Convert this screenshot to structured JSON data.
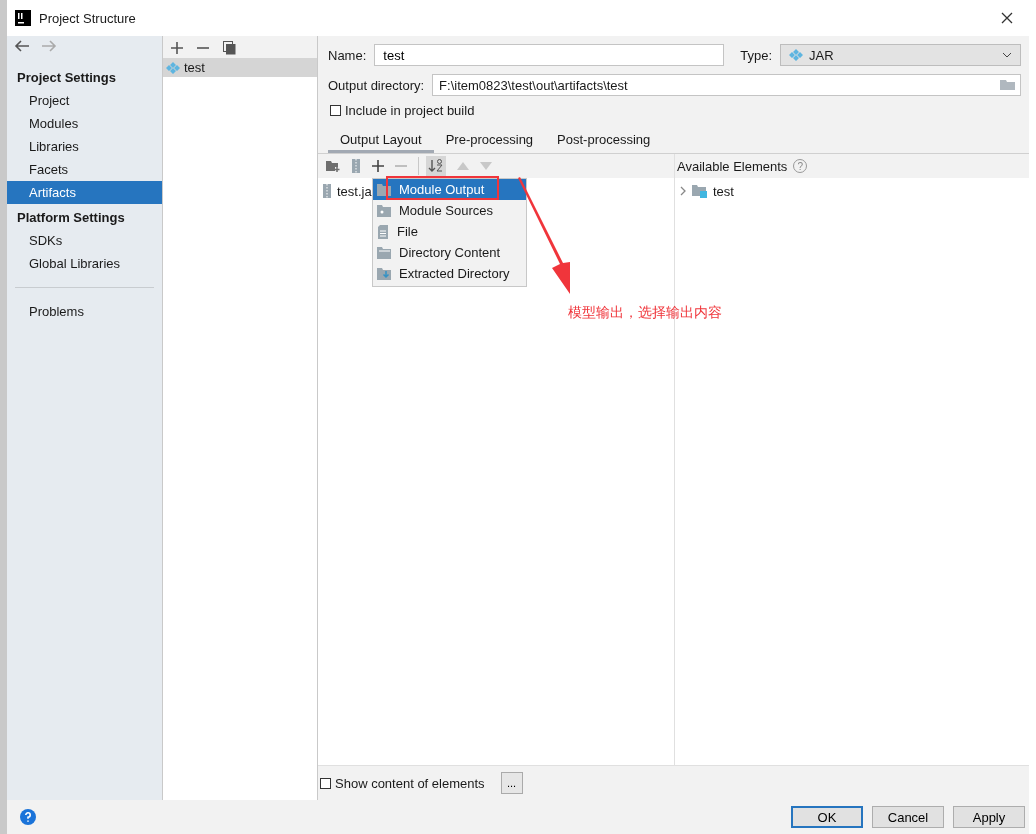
{
  "window": {
    "title": "Project Structure"
  },
  "sidebar": {
    "sections": [
      {
        "title": "Project Settings",
        "items": [
          {
            "label": "Project",
            "selected": false
          },
          {
            "label": "Modules",
            "selected": false
          },
          {
            "label": "Libraries",
            "selected": false
          },
          {
            "label": "Facets",
            "selected": false
          },
          {
            "label": "Artifacts",
            "selected": true
          }
        ]
      },
      {
        "title": "Platform Settings",
        "items": [
          {
            "label": "SDKs",
            "selected": false
          },
          {
            "label": "Global Libraries",
            "selected": false
          }
        ]
      }
    ],
    "extra_items": [
      {
        "label": "Problems",
        "selected": false
      }
    ]
  },
  "artifacts": [
    {
      "name": "test",
      "selected": true
    }
  ],
  "form": {
    "name_label": "Name:",
    "name": "test",
    "type_label": "Type:",
    "type": "JAR",
    "output_label": "Output directory:",
    "output": "F:\\item0823\\test\\out\\artifacts\\test",
    "include_label": "Include in project build",
    "include_checked": false
  },
  "tabs": [
    {
      "label": "Output Layout",
      "selected": true
    },
    {
      "label": "Pre-processing",
      "selected": false
    },
    {
      "label": "Post-processing",
      "selected": false
    }
  ],
  "layout_tree": [
    {
      "label": "test.ja"
    }
  ],
  "available": {
    "title": "Available Elements",
    "help": "?",
    "items": [
      {
        "label": "test",
        "expanded": false
      }
    ]
  },
  "menu": [
    {
      "label": "Module Output",
      "kind": "module-output",
      "selected": true
    },
    {
      "label": "Module Sources",
      "kind": "module-sources",
      "selected": false
    },
    {
      "label": "File",
      "kind": "file",
      "selected": false
    },
    {
      "label": "Directory Content",
      "kind": "directory",
      "selected": false
    },
    {
      "label": "Extracted Directory",
      "kind": "extracted",
      "selected": false
    }
  ],
  "annotation": "模型输出，选择输出内容",
  "show_content": {
    "label": "Show content of elements",
    "checked": false,
    "more": "..."
  },
  "buttons": [
    {
      "label": "OK",
      "default": true
    },
    {
      "label": "Cancel",
      "default": false
    },
    {
      "label": "Apply",
      "default": false
    }
  ]
}
